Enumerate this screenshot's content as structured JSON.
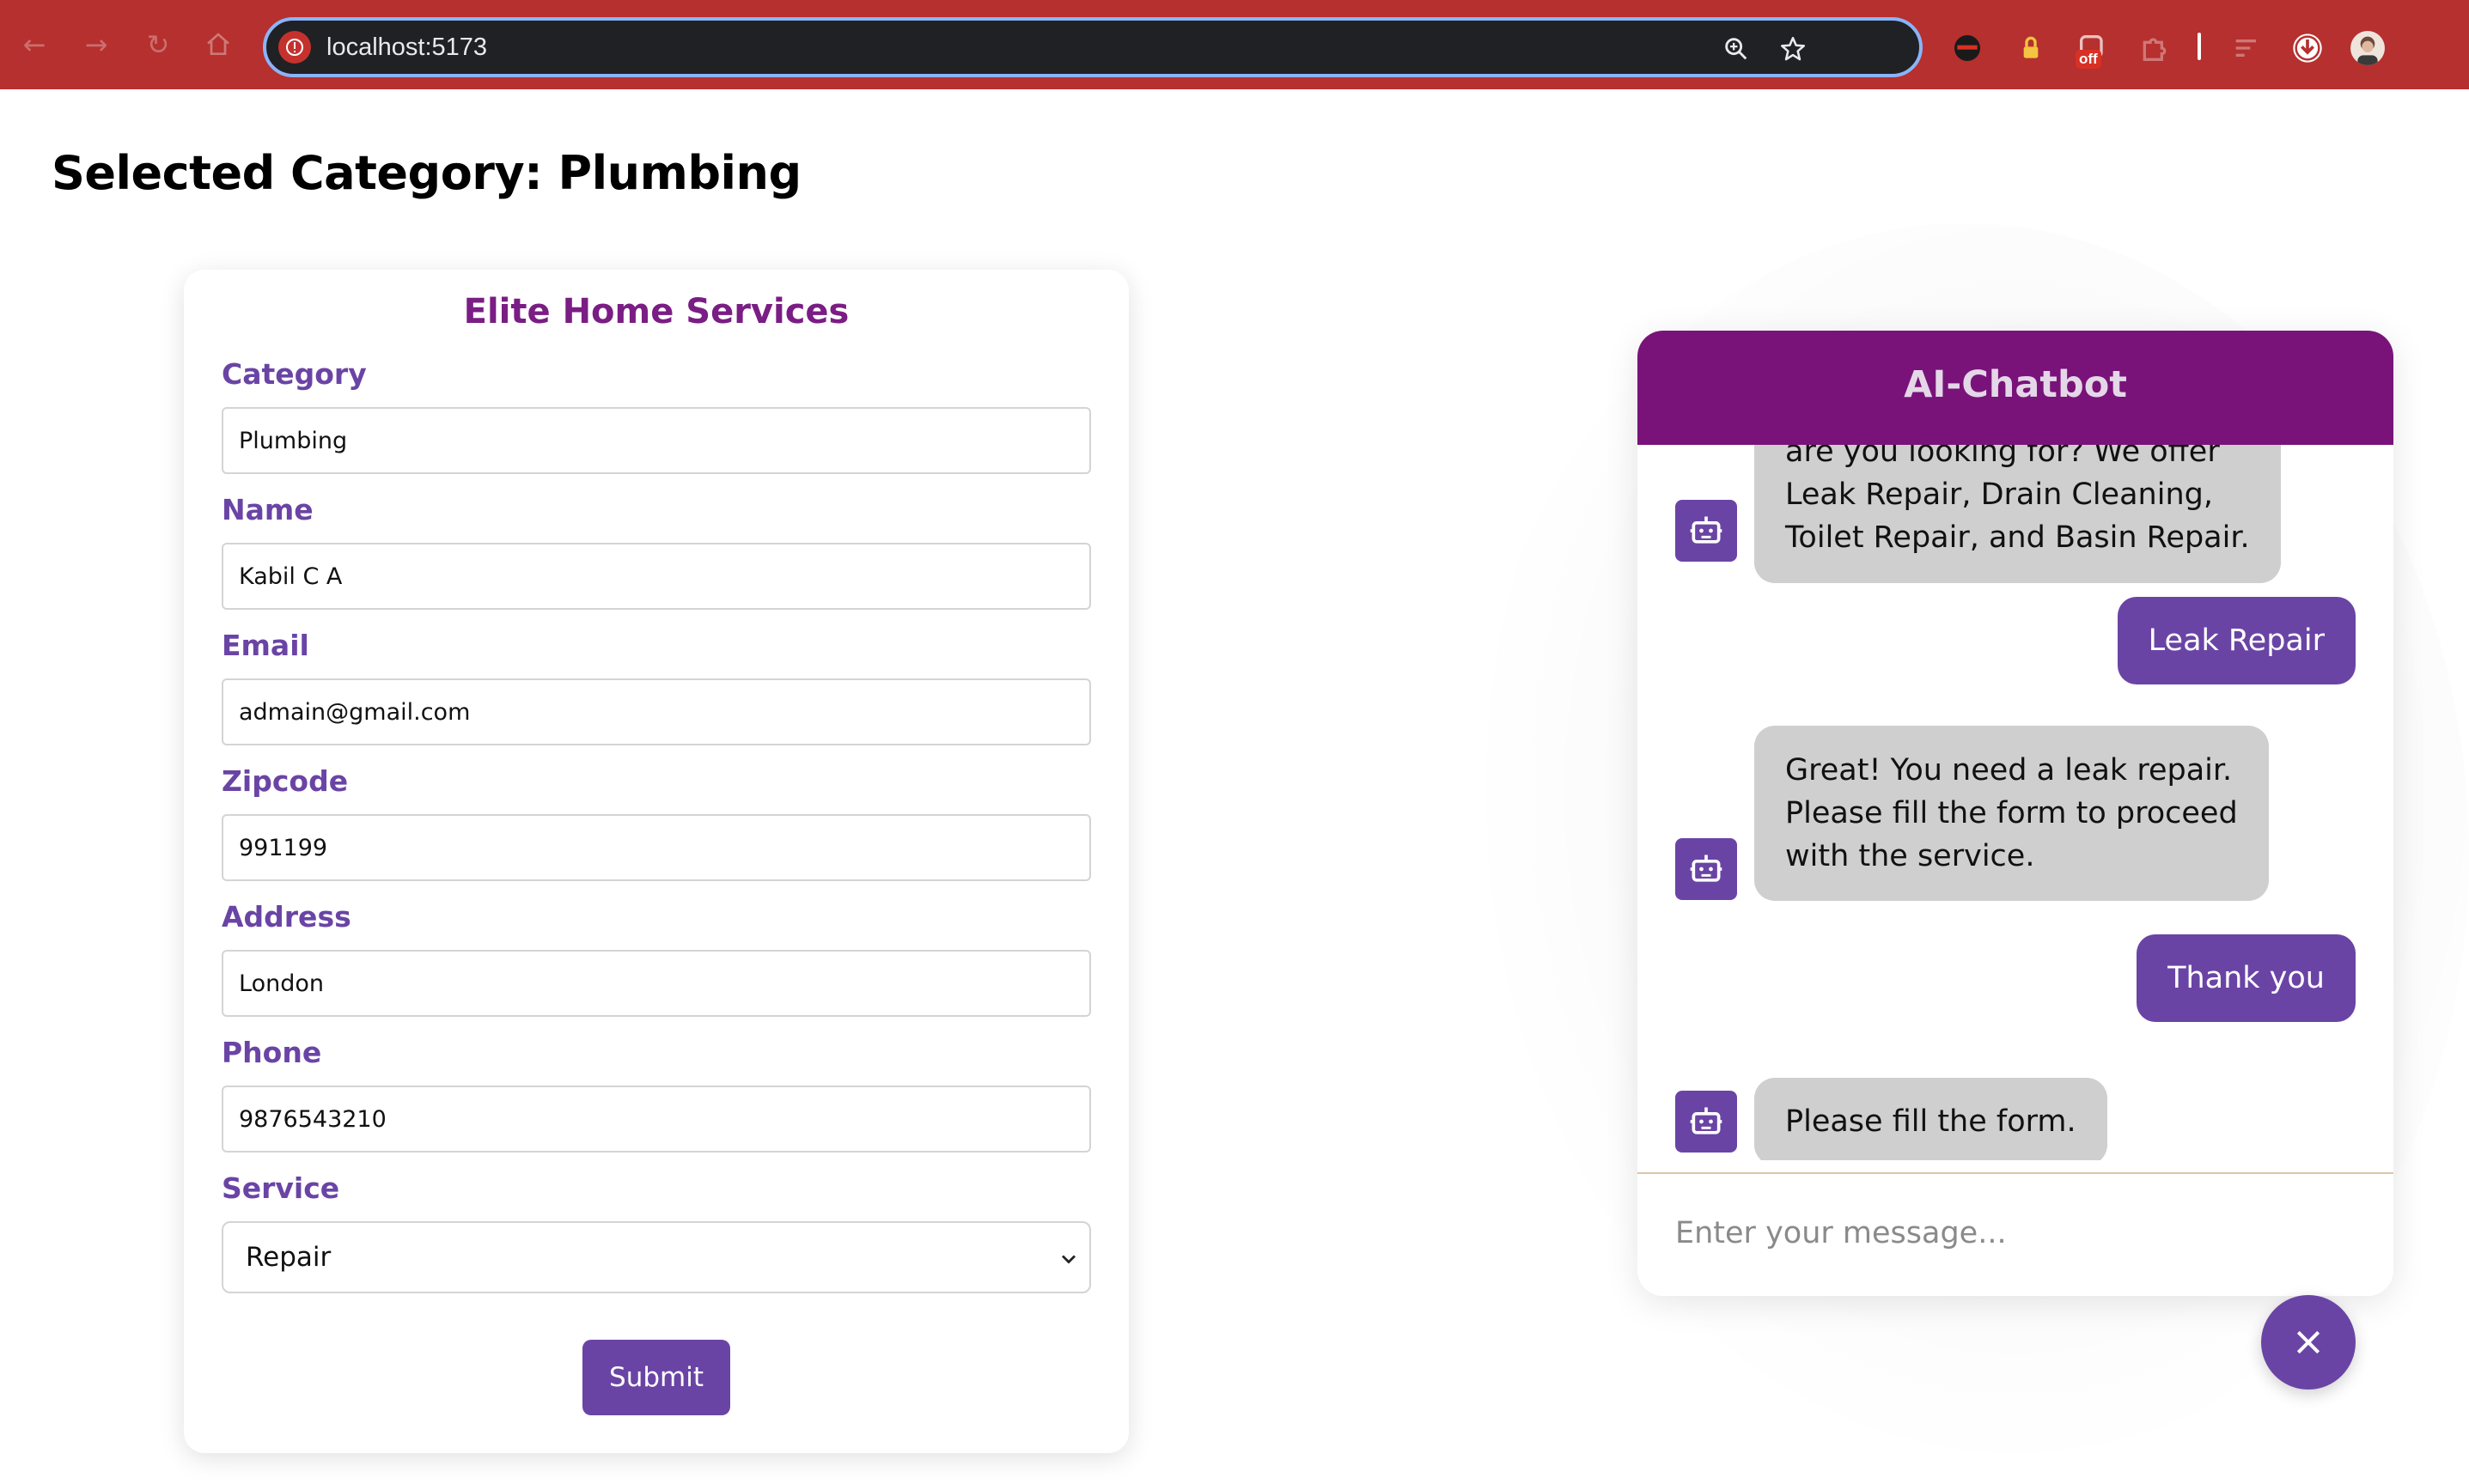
{
  "browser": {
    "url": "localhost:5173",
    "extension_badge": "off",
    "icons": [
      "back-icon",
      "forward-icon",
      "reload-icon",
      "home-icon",
      "site-info-icon",
      "zoom-icon",
      "bookmark-star-icon",
      "extension-ninja-icon",
      "extension-lock-icon",
      "extension-off-icon",
      "extensions-puzzle-icon",
      "reading-list-icon",
      "download-icon",
      "profile-avatar"
    ]
  },
  "page": {
    "title": "Selected Category: Plumbing"
  },
  "form": {
    "title": "Elite Home Services",
    "fields": [
      {
        "label": "Category",
        "value": "Plumbing"
      },
      {
        "label": "Name",
        "value": "Kabil C A"
      },
      {
        "label": "Email",
        "value": "admain@gmail.com"
      },
      {
        "label": "Zipcode",
        "value": "991199"
      },
      {
        "label": "Address",
        "value": "London"
      },
      {
        "label": "Phone",
        "value": "9876543210"
      }
    ],
    "service": {
      "label": "Service",
      "value": "Repair"
    },
    "submit_label": "Submit"
  },
  "chatbot": {
    "title": "AI-Chatbot",
    "messages": [
      {
        "from": "bot",
        "lines": [
          "are you looking for? We offer",
          "Leak Repair, Drain Cleaning,",
          "Toilet Repair, and Basin Repair."
        ]
      },
      {
        "from": "user",
        "text": "Leak Repair"
      },
      {
        "from": "bot",
        "lines": [
          "Great! You need a leak repair.",
          "Please fill the form to proceed",
          "with the service."
        ]
      },
      {
        "from": "user",
        "text": "Thank you"
      },
      {
        "from": "bot",
        "lines": [
          "Please fill the form."
        ]
      }
    ],
    "input_placeholder": "Enter your message..."
  },
  "colors": {
    "browser_bar": "#b5302e",
    "form_title": "#7a1d84",
    "label": "#6a44a5",
    "accent_purple": "#6a44a5",
    "chat_header": "#791379",
    "bot_bubble": "#cfcfcf"
  }
}
